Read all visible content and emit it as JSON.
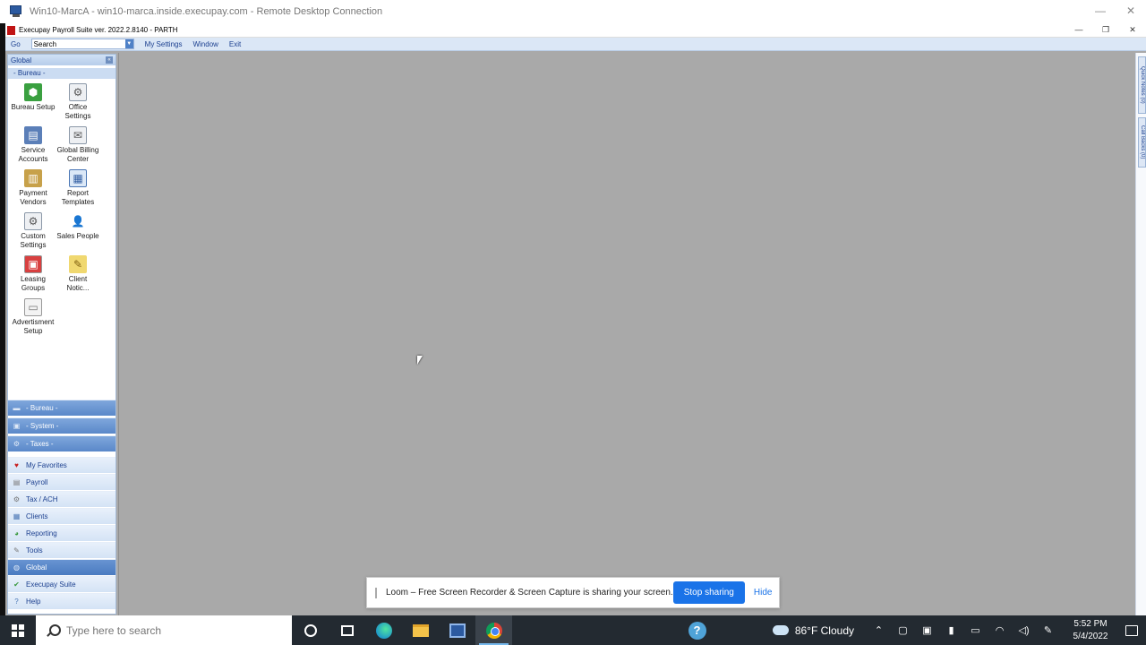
{
  "rdp": {
    "title": "Win10-MarcA - win10-marca.inside.execupay.com - Remote Desktop Connection",
    "minimize": "—",
    "close": "✕"
  },
  "app": {
    "title": "Execupay Payroll Suite ver. 2022.2.8140 - PARTH",
    "minimize": "—",
    "restore": "❐",
    "close": "✕"
  },
  "menu": {
    "go": "Go",
    "search_value": "Search",
    "my_settings": "My Settings",
    "window": "Window",
    "exit": "Exit"
  },
  "nav": {
    "header": "Global",
    "section": "- Bureau -",
    "tiles": [
      {
        "label": "Bureau Setup",
        "icon": "bureau-setup-icon"
      },
      {
        "label": "Office\nSettings",
        "icon": "office-settings-icon"
      },
      {
        "label": "Service\nAccounts",
        "icon": "service-accounts-icon"
      },
      {
        "label": "Global Billing\nCenter",
        "icon": "billing-center-icon"
      },
      {
        "label": "Payment\nVendors",
        "icon": "payment-vendors-icon"
      },
      {
        "label": "Report\nTemplates",
        "icon": "report-templates-icon"
      },
      {
        "label": "Custom\nSettings",
        "icon": "custom-settings-icon"
      },
      {
        "label": "Sales People",
        "icon": "sales-people-icon"
      },
      {
        "label": "Leasing\nGroups",
        "icon": "leasing-groups-icon"
      },
      {
        "label": "Client\nNotic...",
        "icon": "client-notices-icon"
      },
      {
        "label": "Advertisment\nSetup",
        "icon": "advertisment-setup-icon"
      }
    ],
    "subsections": [
      "- Bureau -",
      "- System -",
      "- Taxes -"
    ],
    "modules": [
      "My Favorites",
      "Payroll",
      "Tax / ACH",
      "Clients",
      "Reporting",
      "Tools",
      "Global",
      "Execupay Suite",
      "Help"
    ]
  },
  "right_tabs": [
    "Quick Notes (0)",
    "Call Backs (0)"
  ],
  "loom": {
    "message": "Loom – Free Screen Recorder & Screen Capture is sharing your screen.",
    "stop": "Stop sharing",
    "hide": "Hide"
  },
  "taskbar": {
    "search_placeholder": "Type here to search",
    "weather": "86°F  Cloudy",
    "time": "5:52 PM",
    "date": "5/4/2022"
  }
}
